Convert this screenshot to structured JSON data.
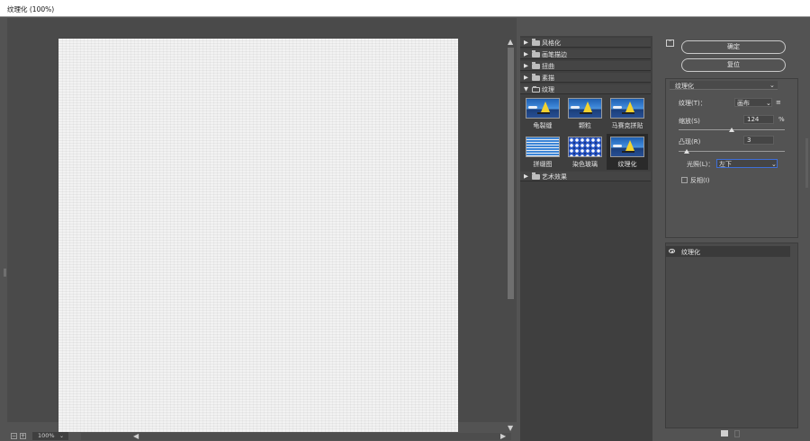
{
  "window": {
    "title": "纹理化 (100%)"
  },
  "preview": {
    "zoom": "100%"
  },
  "gallery": {
    "categories": [
      {
        "label": "风格化",
        "expanded": false
      },
      {
        "label": "画笔描边",
        "expanded": false
      },
      {
        "label": "扭曲",
        "expanded": false
      },
      {
        "label": "素描",
        "expanded": false
      },
      {
        "label": "纹理",
        "expanded": true
      },
      {
        "label": "艺术效果",
        "expanded": false
      }
    ],
    "filters": [
      "龟裂缝",
      "颗粒",
      "马赛克拼贴",
      "拼缀图",
      "染色玻璃",
      "纹理化"
    ],
    "selected_filter": "纹理化"
  },
  "buttons": {
    "ok": "确定",
    "reset": "复位"
  },
  "settings": {
    "filter_select": "纹理化",
    "texture_label": "纹理(T)：",
    "texture_value": "画布",
    "texture_menu_icon": "≡",
    "scaling_label": "缩放(S)",
    "scaling_value": "124",
    "scaling_unit": "%",
    "relief_label": "凸现(R)",
    "relief_value": "3",
    "light_label": "光照(L)：",
    "light_value": "左下",
    "invert_label": "反相(I)",
    "invert_checked": false
  },
  "layers": [
    {
      "name": "纹理化",
      "visible": true
    }
  ],
  "colors": {
    "panel": "#535353",
    "dark": "#3f3f3f",
    "focus": "#3f6fd8"
  }
}
